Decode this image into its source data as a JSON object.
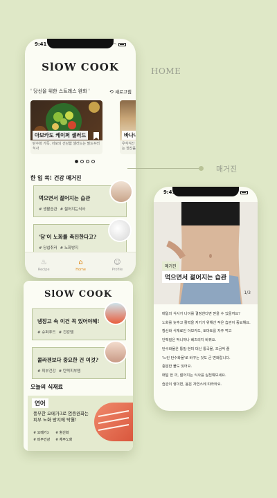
{
  "phone_a": {
    "status_time": "9:41",
    "brand": "SlOW COOK",
    "section_title": "' 당신을 위한 스트레스 완화 '",
    "refresh_label": "새로고침",
    "cards": [
      {
        "title": "아보카도 케이퍼 샐러드",
        "caption": "탄수화 가득, 저포의 건강함 샐러드는 필드꾸러 식사"
      },
      {
        "title": "바나나 두유 스무디",
        "caption": "우식식간 대표 알곤한 바나나로 레혀라고 양있는 한잔음료"
      }
    ],
    "magazine_title": "한 입 쏙! 건강 매거진",
    "magazine_items": [
      {
        "title": "먹으면서 젊어지는 습관",
        "tags": [
          "# 생활습관",
          "# 젊어지는식사"
        ]
      },
      {
        "title": "'당'이 노화를 촉진한다고?",
        "tags": [
          "# 당섭취러",
          "# 노화방지"
        ]
      }
    ],
    "tabs": [
      {
        "label": "Recipe",
        "icon": "chef-hat-icon"
      },
      {
        "label": "Home",
        "icon": "home-icon"
      },
      {
        "label": "Profile",
        "icon": "profile-icon"
      }
    ]
  },
  "phone_b": {
    "brand": "SlOW COOK",
    "items": [
      {
        "title": "냉장고 속 이건 꼭 있어야해!",
        "tags": [
          "# 슈퍼푸드",
          "# 건강템"
        ]
      },
      {
        "title": "콜라겐보다 중요한 건 이것?",
        "tags": [
          "# 피부건강",
          "# 탄력피부템"
        ]
      }
    ],
    "food_title": "오늘의 식재료",
    "food_label": "연어",
    "food_desc_1": "풍부한 오메가3로 염증완화는",
    "food_desc_2": "피부 노화 방지에 탁월!",
    "food_tags": [
      "# 오메가3",
      "# 항산화",
      "# 피부건강",
      "# 체주노화"
    ]
  },
  "labels": {
    "home": "HOME",
    "magazine": "매거진"
  },
  "phone_c": {
    "status_time": "9:41",
    "badge": "매거진",
    "title": "먹으면서 젊어지는 습관",
    "page": "1/3",
    "lines": [
      "매일의 식사가 나이를 결정한다면 믿을 수 있을까요?",
      "노화를 늦추고 활력을 지키기 위해선 작은 습관이 중요해요.",
      "항산화 식재료인 아보카도, 토마토를 자주 먹고",
      "단백질은 떡니까나 베즈리지 바꿔요.",
      "탄수화물은 통밀·현미 대신 통곡물, 조금씩 줄",
      "'느린 탄수화물'로 바꾸는 것도 큰 변화랍니다.",
      "충분한 물도 잊어요.",
      "매일 한 끼, 젊어지는 식사를 실천해보세요.",
      "습관이 쌓이면, 몸은 자연스레 따라와요."
    ]
  }
}
